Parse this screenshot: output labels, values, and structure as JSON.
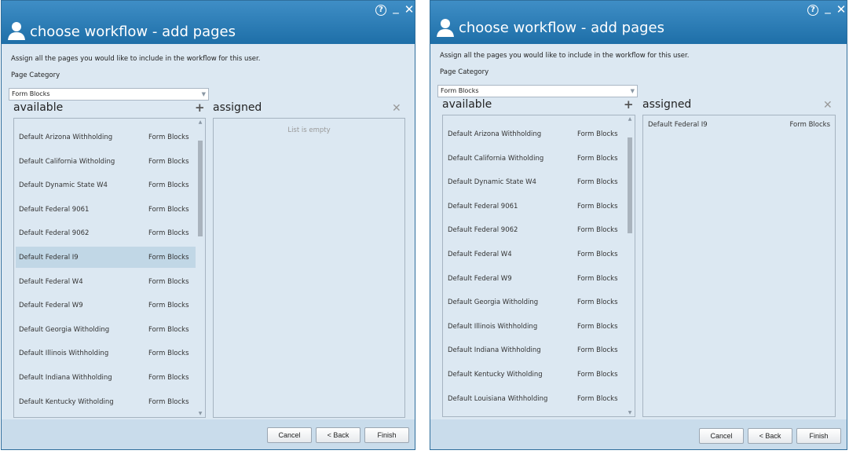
{
  "dialogs": [
    {
      "title": "choose workflow - add pages",
      "instructions": "Assign all the pages you would like to include in the workflow for this user.",
      "category_label": "Page Category",
      "category_value": "Form Blocks",
      "available_heading": "available",
      "assigned_heading": "assigned",
      "available": [
        {
          "name": "Default Arizona Withholding",
          "category": "Form Blocks"
        },
        {
          "name": "Default California Witholding",
          "category": "Form Blocks"
        },
        {
          "name": "Default Dynamic State W4",
          "category": "Form Blocks"
        },
        {
          "name": "Default Federal 9061",
          "category": "Form Blocks"
        },
        {
          "name": "Default Federal 9062",
          "category": "Form Blocks"
        },
        {
          "name": "Default Federal I9",
          "category": "Form Blocks"
        },
        {
          "name": "Default Federal W4",
          "category": "Form Blocks"
        },
        {
          "name": "Default Federal W9",
          "category": "Form Blocks"
        },
        {
          "name": "Default Georgia Witholding",
          "category": "Form Blocks"
        },
        {
          "name": "Default Illinois Withholding",
          "category": "Form Blocks"
        },
        {
          "name": "Default Indiana Withholding",
          "category": "Form Blocks"
        },
        {
          "name": "Default Kentucky Witholding",
          "category": "Form Blocks"
        }
      ],
      "selected_available_index": 5,
      "assigned": [],
      "assigned_empty_text": "List is empty",
      "buttons": {
        "cancel": "Cancel",
        "back": "< Back",
        "finish": "Finish"
      }
    },
    {
      "title": "choose workflow - add pages",
      "instructions": "Assign all the pages you would like to include in the workflow for this user.",
      "category_label": "Page Category",
      "category_value": "Form Blocks",
      "available_heading": "available",
      "assigned_heading": "assigned",
      "available": [
        {
          "name": "Default Arizona Withholding",
          "category": "Form Blocks"
        },
        {
          "name": "Default California Witholding",
          "category": "Form Blocks"
        },
        {
          "name": "Default Dynamic State W4",
          "category": "Form Blocks"
        },
        {
          "name": "Default Federal 9061",
          "category": "Form Blocks"
        },
        {
          "name": "Default Federal 9062",
          "category": "Form Blocks"
        },
        {
          "name": "Default Federal W4",
          "category": "Form Blocks"
        },
        {
          "name": "Default Federal W9",
          "category": "Form Blocks"
        },
        {
          "name": "Default Georgia Witholding",
          "category": "Form Blocks"
        },
        {
          "name": "Default Illinois Withholding",
          "category": "Form Blocks"
        },
        {
          "name": "Default Indiana Withholding",
          "category": "Form Blocks"
        },
        {
          "name": "Default Kentucky Witholding",
          "category": "Form Blocks"
        },
        {
          "name": "Default Louisiana Withholding",
          "category": "Form Blocks"
        }
      ],
      "selected_available_index": -1,
      "assigned": [
        {
          "name": "Default Federal I9",
          "category": "Form Blocks"
        }
      ],
      "assigned_empty_text": "",
      "buttons": {
        "cancel": "Cancel",
        "back": "< Back",
        "finish": "Finish"
      }
    }
  ],
  "icons": {
    "user": "person-icon",
    "help": "help-icon",
    "minimize": "minimize-icon",
    "close": "close-icon",
    "add": "plus-icon",
    "clear": "x-icon",
    "dropdown": "chevron-down-icon"
  },
  "colors": {
    "titlebar": "#2a7fbb",
    "body": "#dce8f2",
    "selected_row": "#c1d7e6",
    "footer": "#c9dceb"
  }
}
